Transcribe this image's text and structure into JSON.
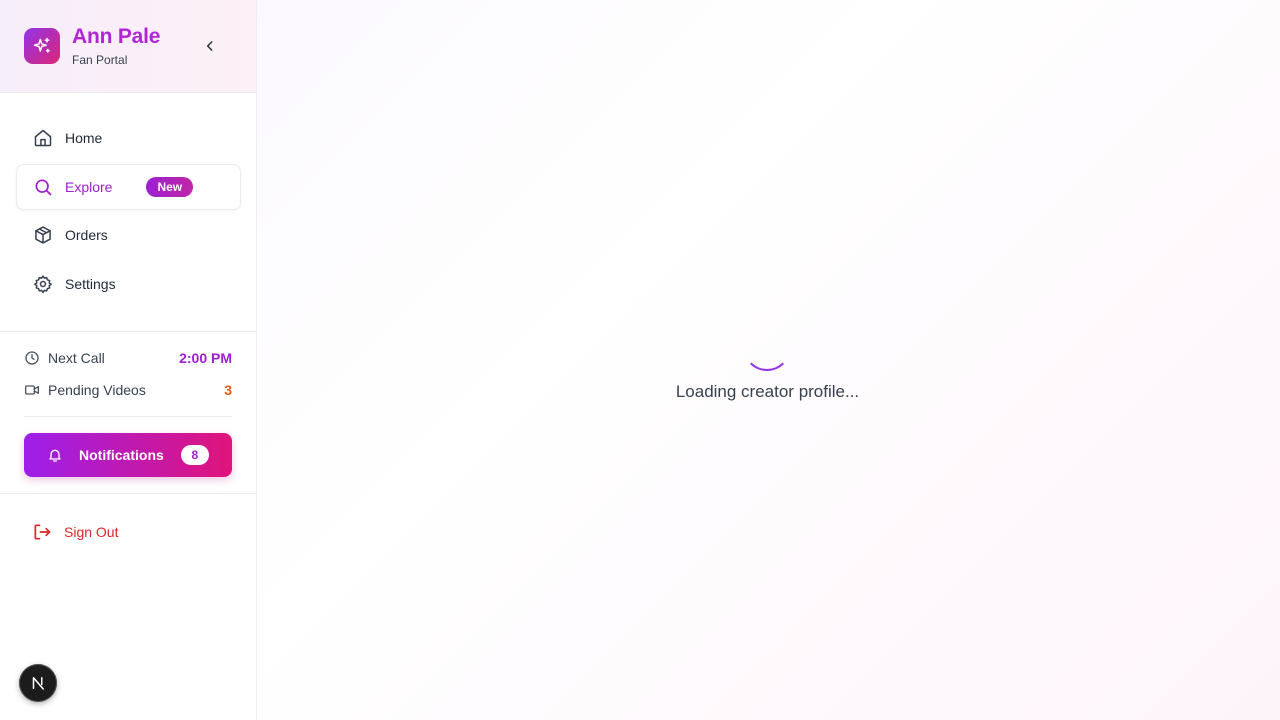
{
  "brand": {
    "title": "Ann Pale",
    "subtitle": "Fan Portal"
  },
  "nav": {
    "items": [
      {
        "label": "Home",
        "icon": "home-icon"
      },
      {
        "label": "Explore",
        "icon": "search-icon",
        "badge": "New",
        "active": true
      },
      {
        "label": "Orders",
        "icon": "package-icon"
      },
      {
        "label": "Settings",
        "icon": "gear-icon"
      }
    ]
  },
  "stats": {
    "next_call_label": "Next Call",
    "next_call_value": "2:00 PM",
    "pending_videos_label": "Pending Videos",
    "pending_videos_value": "3"
  },
  "notifications": {
    "label": "Notifications",
    "count": "8"
  },
  "sign_out": {
    "label": "Sign Out"
  },
  "main": {
    "loading_text": "Loading creator profile..."
  },
  "colors": {
    "brand_purple": "#9d1fd0",
    "brand_pink": "#db2777",
    "danger": "#dc2626",
    "accent_orange": "#ea580c"
  }
}
